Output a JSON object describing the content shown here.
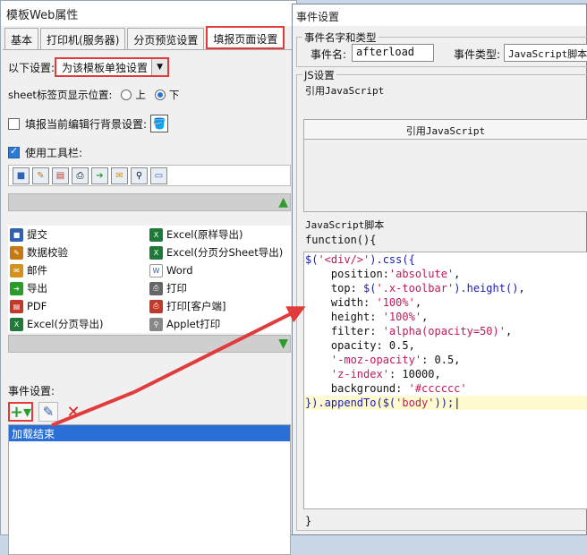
{
  "left_window": {
    "title": "模板Web属性",
    "tabs": [
      {
        "label": "基本"
      },
      {
        "label": "打印机(服务器)"
      },
      {
        "label": "分页预览设置"
      },
      {
        "label": "填报页面设置"
      }
    ],
    "settings_label": "以下设置:",
    "settings_value": "为该模板单独设置",
    "sheet_label": "sheet标签页显示位置:",
    "sheet_top": "上",
    "sheet_bottom": "下",
    "bg_label": "填报当前编辑行背景设置:",
    "use_toolbar_label": "使用工具栏:",
    "buttons": {
      "submit": "提交",
      "excel_orig": "Excel(原样导出)",
      "validate": "数据校验",
      "excel_sheet": "Excel(分页分Sheet导出)",
      "mail": "邮件",
      "word": "Word",
      "export": "导出",
      "print": "打印",
      "pdf": "PDF",
      "print_client": "打印[客户端]",
      "excel_page": "Excel(分页导出)",
      "applet_print": "Applet打印"
    },
    "event_settings_label": "事件设置:",
    "event_item": "加载结束"
  },
  "dialog": {
    "title": "事件设置",
    "name_group": "事件名字和类型",
    "name_label": "事件名:",
    "name_value": "afterload",
    "type_label": "事件类型:",
    "type_value": "JavaScript脚本",
    "js_group": "JS设置",
    "ref_group": "引用JavaScript",
    "ref_header": "引用JavaScript",
    "script_group": "JavaScript脚本",
    "func_open": "function(){",
    "func_close": "}",
    "code_lines": [
      "$('<div/>').css({",
      "    position:'absolute',",
      "    top: $('.x-toolbar').height(),",
      "    width: '100%',",
      "    height: '100%',",
      "    filter: 'alpha(opacity=50)',",
      "    opacity: 0.5,",
      "    '-moz-opacity': 0.5,",
      "    'z-index': 10000,",
      "    background: '#cccccc'",
      "}).appendTo($('body'));"
    ]
  },
  "colors": {
    "highlight_red": "#e23b3b",
    "selection_blue": "#2a6fd6"
  }
}
